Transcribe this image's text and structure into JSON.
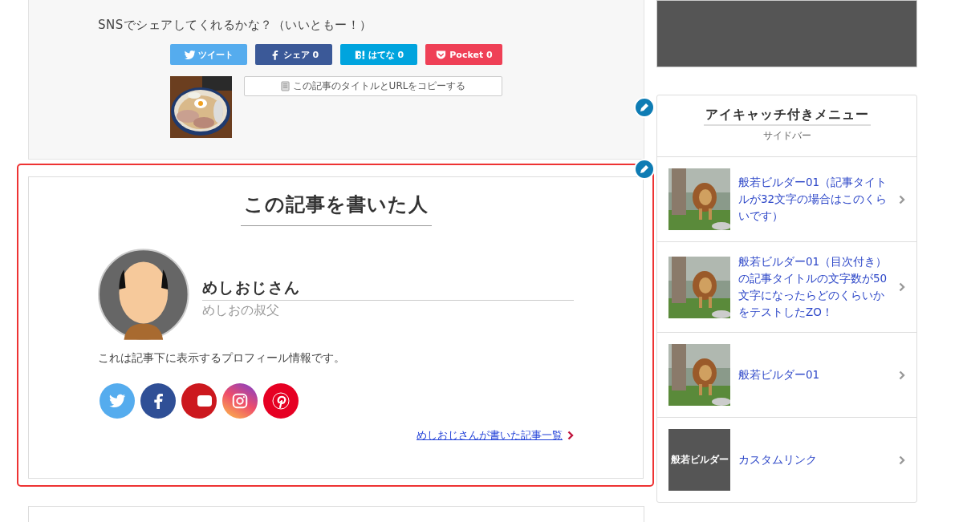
{
  "share": {
    "prompt": "SNSでシェアしてくれるかな？（いいともー！）",
    "buttons": [
      {
        "kind": "twitter",
        "label": "ツイート",
        "color": "#55acee"
      },
      {
        "kind": "facebook",
        "label": "シェア 0",
        "color": "#3b5998"
      },
      {
        "kind": "hatena",
        "label": "はてな 0",
        "color": "#00a4de"
      },
      {
        "kind": "pocket",
        "label": "Pocket 0",
        "color": "#ef4056"
      }
    ],
    "copy_button": "この記事のタイトルとURLをコピーする"
  },
  "author_box": {
    "heading": "この記事を書いた人",
    "name": "めしおじさん",
    "role": "めしおの叔父",
    "bio": "これは記事下に表示するプロフィール情報です。",
    "socials": [
      {
        "kind": "twitter"
      },
      {
        "kind": "facebook"
      },
      {
        "kind": "youtube"
      },
      {
        "kind": "instagram"
      },
      {
        "kind": "pinterest"
      }
    ],
    "articles_link": "めしおじさんが書いた記事一覧"
  },
  "sidebar": {
    "title": "アイキャッチ付きメニュー",
    "subtitle": "サイドバー",
    "items": [
      {
        "kind": "picture",
        "label": "般若ビルダー01（記事タイトルが32文字の場合はこのくらいです）"
      },
      {
        "kind": "picture",
        "label": "般若ビルダー01（目次付き）の記事タイトルの文字数が50文字になったらどのくらいかをテストしたZO！"
      },
      {
        "kind": "picture",
        "label": "般若ビルダー01"
      },
      {
        "kind": "text",
        "thumb_text": "般若ビルダー",
        "label": "カスタムリンク"
      }
    ]
  }
}
